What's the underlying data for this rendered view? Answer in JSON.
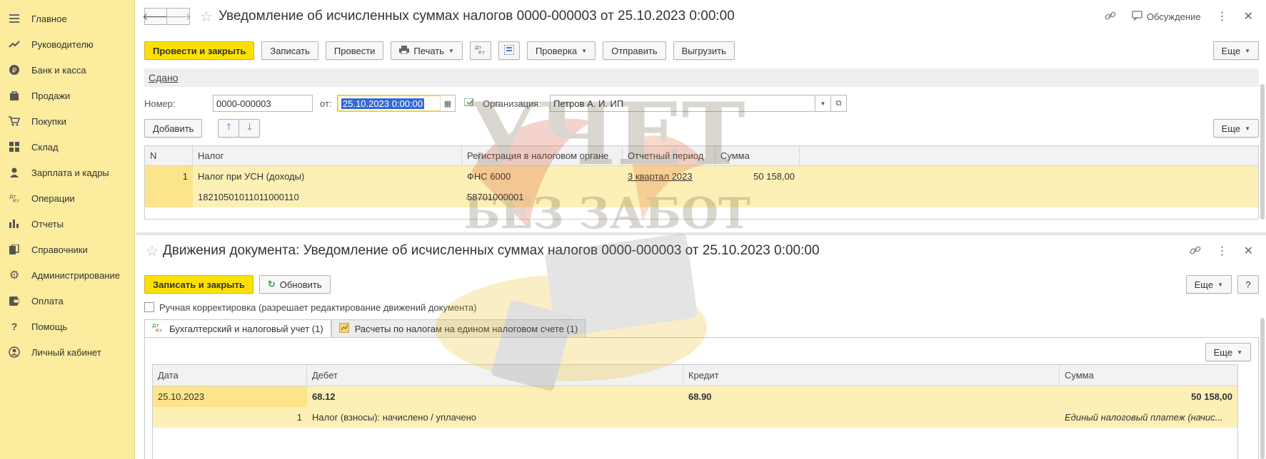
{
  "sidebar": {
    "items": [
      {
        "label": "Главное",
        "icon": "menu-icon"
      },
      {
        "label": "Руководителю",
        "icon": "trend-icon"
      },
      {
        "label": "Банк и касса",
        "icon": "ruble-icon"
      },
      {
        "label": "Продажи",
        "icon": "bag-icon"
      },
      {
        "label": "Покупки",
        "icon": "cart-icon"
      },
      {
        "label": "Склад",
        "icon": "warehouse-icon"
      },
      {
        "label": "Зарплата и кадры",
        "icon": "person-icon"
      },
      {
        "label": "Операции",
        "icon": "dt-kt-icon"
      },
      {
        "label": "Отчеты",
        "icon": "bar-chart-icon"
      },
      {
        "label": "Справочники",
        "icon": "books-icon"
      },
      {
        "label": "Администрирование",
        "icon": "gear-icon"
      },
      {
        "label": "Оплата",
        "icon": "wallet-icon"
      },
      {
        "label": "Помощь",
        "icon": "question-icon"
      },
      {
        "label": "Личный кабинет",
        "icon": "user-circle-icon"
      }
    ]
  },
  "document": {
    "title": "Уведомление об исчисленных суммах налогов 0000-000003 от 25.10.2023 0:00:00",
    "discussion": "Обсуждение",
    "toolbar": {
      "post_close": "Провести и закрыть",
      "save": "Записать",
      "post": "Провести",
      "print": "Печать",
      "check": "Проверка",
      "send": "Отправить",
      "export": "Выгрузить",
      "more": "Еще"
    },
    "status": "Сдано",
    "number_label": "Номер:",
    "number_value": "0000-000003",
    "date_label": "от:",
    "date_value": "25.10.2023  0:00:00",
    "org_label": "Организация:",
    "org_value": "Петров А. И. ИП",
    "add_button": "Добавить",
    "more2": "Еще",
    "table": {
      "columns": [
        "N",
        "Налог",
        "Регистрация в налоговом органе",
        "Отчетный период",
        "Сумма"
      ],
      "row": {
        "n": "1",
        "tax": "Налог при УСН (доходы)",
        "kbk": "18210501011011000110",
        "registration": "ФНС 6000",
        "oktmo": "58701000001",
        "period": "3 квартал 2023",
        "amount": "50 158,00"
      }
    }
  },
  "movements": {
    "title": "Движения документа: Уведомление об исчисленных суммах налогов 0000-000003 от 25.10.2023 0:00:00",
    "save_close": "Записать и закрыть",
    "refresh": "Обновить",
    "more": "Еще",
    "help": "?",
    "manual_label": "Ручная корректировка (разрешает редактирование движений документа)",
    "tabs": [
      "Бухгалтерский и налоговый учет (1)",
      "Расчеты по налогам на едином налоговом счете (1)"
    ],
    "panel_more": "Еще",
    "table": {
      "columns": [
        "Дата",
        "Дебет",
        "Кредит",
        "Сумма"
      ],
      "row": {
        "date": "25.10.2023",
        "num": "1",
        "debit": "68.12",
        "credit": "68.90",
        "amount": "50 158,00",
        "debit_desc": "Налог (взносы): начислено / уплачено",
        "content": "Единый налоговый платеж (начис..."
      }
    }
  },
  "watermark": {
    "line1": "УЧЕТ",
    "line2": "БЕЗ ЗАБОТ"
  },
  "colors": {
    "sidebar": "#fbec9e",
    "primary_button": "#fce100",
    "row_selected": "#fdf0b6",
    "selection": "#3568d4"
  }
}
